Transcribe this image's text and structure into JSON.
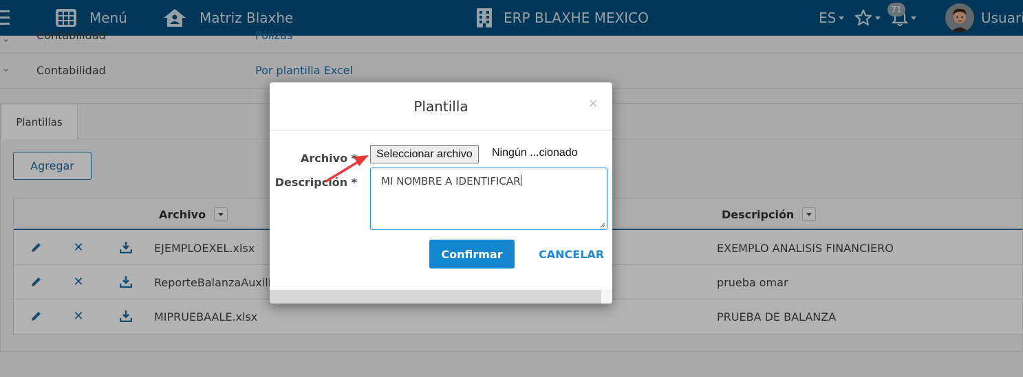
{
  "topbar": {
    "menu_label": "Menú",
    "home_label": "Matriz Blaxhe",
    "company": "ERP BLAXHE MEXICO",
    "language": "ES",
    "notifications_count": "71",
    "user_label": "Usuario",
    "bar_color": "#004f7f"
  },
  "breadcrumb_rows": [
    {
      "module": "Contabilidad",
      "link": "Pólizas"
    },
    {
      "module": "Contabilidad",
      "link": "Por plantilla Excel"
    }
  ],
  "panel": {
    "tab_label": "Plantillas",
    "add_button": "Agregar",
    "columns": {
      "archivo": "Archivo",
      "descripcion": "Descripción"
    },
    "rows": [
      {
        "archivo": "EJEMPLOEXEL.xlsx",
        "descripcion": "EXEMPLO ANALISIS FINANCIERO"
      },
      {
        "archivo": "ReporteBalanzaAuxiliar",
        "descripcion": "prueba omar"
      },
      {
        "archivo": "MIPRUEBAALE.xlsx",
        "descripcion": "PRUEBA DE BALANZA"
      }
    ]
  },
  "modal": {
    "title": "Plantilla",
    "close_symbol": "×",
    "archivo_label": "Archivo *",
    "file_button": "Seleccionar archivo",
    "file_status": "Ningún ...cionado",
    "descripcion_label": "Descripción *",
    "descripcion_value": "MI NOMBRE A IDENTIFICAR",
    "confirm_button": "Confirmar",
    "cancel_button": "CANCELAR",
    "accent_color": "#1386cf"
  },
  "annotation": {
    "arrow_color": "#e8383b"
  }
}
